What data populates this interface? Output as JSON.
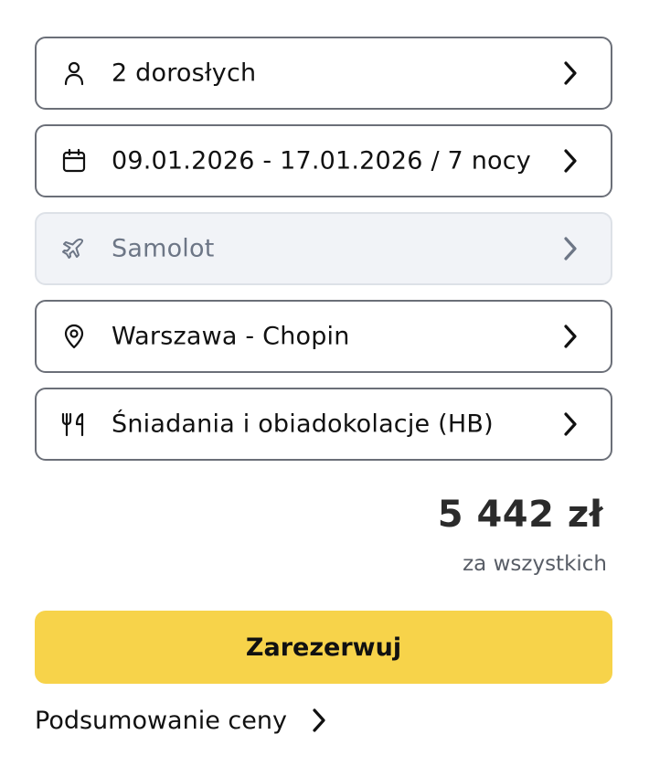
{
  "options": {
    "travelers": {
      "label": "2 dorosłych",
      "icon": "person-icon"
    },
    "dates": {
      "label": "09.01.2026 - 17.01.2026 / 7 nocy",
      "icon": "calendar-icon"
    },
    "transport": {
      "label": "Samolot",
      "icon": "airplane-icon",
      "disabled": true
    },
    "departure": {
      "label": "Warszawa - Chopin",
      "icon": "location-pin-icon"
    },
    "meals": {
      "label": "Śniadania i obiadokolacje (HB)",
      "icon": "cutlery-icon"
    }
  },
  "price": {
    "amount": "5 442 zł",
    "note": "za wszystkich"
  },
  "book_button": {
    "label": "Zarezerwuj"
  },
  "summary_link": {
    "label": "Podsumowanie ceny"
  },
  "colors": {
    "accent": "#f7d34a",
    "border": "#6b6f78",
    "disabled_bg": "#f1f3f7",
    "disabled_text": "#6d7686"
  }
}
